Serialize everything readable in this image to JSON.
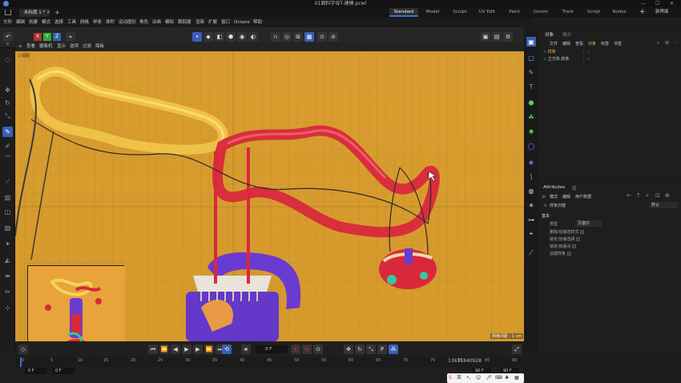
{
  "window": {
    "title": "01面料字母T-建模.pcwl",
    "controls": [
      "—",
      "☐",
      "✕"
    ]
  },
  "tabs": {
    "doc": "未标题 1 *",
    "home_icon": "home-icon",
    "add": "+"
  },
  "layouts": [
    {
      "label": "Standard",
      "active": true
    },
    {
      "label": "Model",
      "active": false
    },
    {
      "label": "Sculpt",
      "active": false
    },
    {
      "label": "UV Edit",
      "active": false
    },
    {
      "label": "Paint",
      "active": false
    },
    {
      "label": "Groom",
      "active": false
    },
    {
      "label": "Track",
      "active": false
    },
    {
      "label": "Script",
      "active": false
    },
    {
      "label": "Nodes",
      "active": false
    }
  ],
  "layout_add": "+",
  "new_layout": "新界面",
  "menu": [
    "文件",
    "编辑",
    "创建",
    "模式",
    "选择",
    "工具",
    "网格",
    "样条",
    "体积",
    "运动图形",
    "角色",
    "动画",
    "模拟",
    "跟踪器",
    "渲染",
    "扩展",
    "窗口",
    "Octane",
    "帮助"
  ],
  "toolbar": {
    "axes": [
      "X",
      "Y",
      "Z"
    ]
  },
  "viewport": {
    "menu": [
      "查看",
      "摄像机",
      "显示",
      "选项",
      "过滤",
      "面板"
    ],
    "label": "三视图",
    "grid_info": "网格间距 : 1 cm"
  },
  "timeline": {
    "current_frame": "0 F",
    "start": "0 F",
    "start2": "0 F",
    "end": "90 F",
    "end2": "90 F",
    "ticks": [
      "0",
      "5",
      "10",
      "15",
      "20",
      "25",
      "30",
      "35",
      "40",
      "45",
      "50",
      "55",
      "60",
      "65",
      "70",
      "75",
      "80",
      "85",
      "90"
    ],
    "overlay_number": "13631840928"
  },
  "objects": {
    "tabs": [
      "对象",
      "场次"
    ],
    "menu": [
      "文件",
      "编辑",
      "查看",
      "对象",
      "标签",
      "书签"
    ],
    "items": [
      {
        "label": "样条",
        "icon": "spline-icon"
      },
      {
        "label": "立方体.样条",
        "icon": "spline-icon"
      }
    ]
  },
  "attributes": {
    "tab": "Attributes",
    "tab2": "层",
    "menu": [
      "模式",
      "编辑",
      "用户数据"
    ],
    "object": "样条扫描",
    "preset": "默认",
    "section": "基本",
    "type_label": "类型",
    "type_value": "贝塞尔",
    "options": [
      {
        "label": "删除/旧版选样式",
        "checked": false
      },
      {
        "label": "锁定/旧版选择",
        "checked": false
      },
      {
        "label": "锁定/旧版点",
        "checked": false
      },
      {
        "label": "创建样条",
        "checked": false
      }
    ]
  },
  "colors": {
    "accent": "#3a5fb8",
    "viewport_bg": "#d59a2c",
    "red_rope": "#d9283c",
    "yellow_rope": "#f2c64a",
    "purple": "#6a3bd0"
  }
}
